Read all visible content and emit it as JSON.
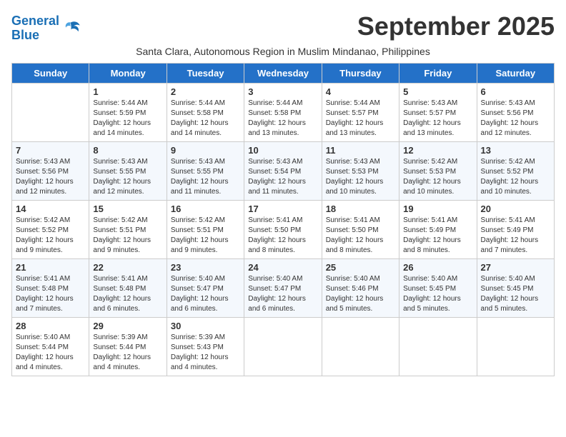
{
  "header": {
    "logo_line1": "General",
    "logo_line2": "Blue",
    "month_title": "September 2025",
    "subtitle": "Santa Clara, Autonomous Region in Muslim Mindanao, Philippines"
  },
  "days_of_week": [
    "Sunday",
    "Monday",
    "Tuesday",
    "Wednesday",
    "Thursday",
    "Friday",
    "Saturday"
  ],
  "weeks": [
    [
      {
        "day": "",
        "info": ""
      },
      {
        "day": "1",
        "info": "Sunrise: 5:44 AM\nSunset: 5:59 PM\nDaylight: 12 hours\nand 14 minutes."
      },
      {
        "day": "2",
        "info": "Sunrise: 5:44 AM\nSunset: 5:58 PM\nDaylight: 12 hours\nand 14 minutes."
      },
      {
        "day": "3",
        "info": "Sunrise: 5:44 AM\nSunset: 5:58 PM\nDaylight: 12 hours\nand 13 minutes."
      },
      {
        "day": "4",
        "info": "Sunrise: 5:44 AM\nSunset: 5:57 PM\nDaylight: 12 hours\nand 13 minutes."
      },
      {
        "day": "5",
        "info": "Sunrise: 5:43 AM\nSunset: 5:57 PM\nDaylight: 12 hours\nand 13 minutes."
      },
      {
        "day": "6",
        "info": "Sunrise: 5:43 AM\nSunset: 5:56 PM\nDaylight: 12 hours\nand 12 minutes."
      }
    ],
    [
      {
        "day": "7",
        "info": "Sunrise: 5:43 AM\nSunset: 5:56 PM\nDaylight: 12 hours\nand 12 minutes."
      },
      {
        "day": "8",
        "info": "Sunrise: 5:43 AM\nSunset: 5:55 PM\nDaylight: 12 hours\nand 12 minutes."
      },
      {
        "day": "9",
        "info": "Sunrise: 5:43 AM\nSunset: 5:55 PM\nDaylight: 12 hours\nand 11 minutes."
      },
      {
        "day": "10",
        "info": "Sunrise: 5:43 AM\nSunset: 5:54 PM\nDaylight: 12 hours\nand 11 minutes."
      },
      {
        "day": "11",
        "info": "Sunrise: 5:43 AM\nSunset: 5:53 PM\nDaylight: 12 hours\nand 10 minutes."
      },
      {
        "day": "12",
        "info": "Sunrise: 5:42 AM\nSunset: 5:53 PM\nDaylight: 12 hours\nand 10 minutes."
      },
      {
        "day": "13",
        "info": "Sunrise: 5:42 AM\nSunset: 5:52 PM\nDaylight: 12 hours\nand 10 minutes."
      }
    ],
    [
      {
        "day": "14",
        "info": "Sunrise: 5:42 AM\nSunset: 5:52 PM\nDaylight: 12 hours\nand 9 minutes."
      },
      {
        "day": "15",
        "info": "Sunrise: 5:42 AM\nSunset: 5:51 PM\nDaylight: 12 hours\nand 9 minutes."
      },
      {
        "day": "16",
        "info": "Sunrise: 5:42 AM\nSunset: 5:51 PM\nDaylight: 12 hours\nand 9 minutes."
      },
      {
        "day": "17",
        "info": "Sunrise: 5:41 AM\nSunset: 5:50 PM\nDaylight: 12 hours\nand 8 minutes."
      },
      {
        "day": "18",
        "info": "Sunrise: 5:41 AM\nSunset: 5:50 PM\nDaylight: 12 hours\nand 8 minutes."
      },
      {
        "day": "19",
        "info": "Sunrise: 5:41 AM\nSunset: 5:49 PM\nDaylight: 12 hours\nand 8 minutes."
      },
      {
        "day": "20",
        "info": "Sunrise: 5:41 AM\nSunset: 5:49 PM\nDaylight: 12 hours\nand 7 minutes."
      }
    ],
    [
      {
        "day": "21",
        "info": "Sunrise: 5:41 AM\nSunset: 5:48 PM\nDaylight: 12 hours\nand 7 minutes."
      },
      {
        "day": "22",
        "info": "Sunrise: 5:41 AM\nSunset: 5:48 PM\nDaylight: 12 hours\nand 6 minutes."
      },
      {
        "day": "23",
        "info": "Sunrise: 5:40 AM\nSunset: 5:47 PM\nDaylight: 12 hours\nand 6 minutes."
      },
      {
        "day": "24",
        "info": "Sunrise: 5:40 AM\nSunset: 5:47 PM\nDaylight: 12 hours\nand 6 minutes."
      },
      {
        "day": "25",
        "info": "Sunrise: 5:40 AM\nSunset: 5:46 PM\nDaylight: 12 hours\nand 5 minutes."
      },
      {
        "day": "26",
        "info": "Sunrise: 5:40 AM\nSunset: 5:45 PM\nDaylight: 12 hours\nand 5 minutes."
      },
      {
        "day": "27",
        "info": "Sunrise: 5:40 AM\nSunset: 5:45 PM\nDaylight: 12 hours\nand 5 minutes."
      }
    ],
    [
      {
        "day": "28",
        "info": "Sunrise: 5:40 AM\nSunset: 5:44 PM\nDaylight: 12 hours\nand 4 minutes."
      },
      {
        "day": "29",
        "info": "Sunrise: 5:39 AM\nSunset: 5:44 PM\nDaylight: 12 hours\nand 4 minutes."
      },
      {
        "day": "30",
        "info": "Sunrise: 5:39 AM\nSunset: 5:43 PM\nDaylight: 12 hours\nand 4 minutes."
      },
      {
        "day": "",
        "info": ""
      },
      {
        "day": "",
        "info": ""
      },
      {
        "day": "",
        "info": ""
      },
      {
        "day": "",
        "info": ""
      }
    ]
  ]
}
